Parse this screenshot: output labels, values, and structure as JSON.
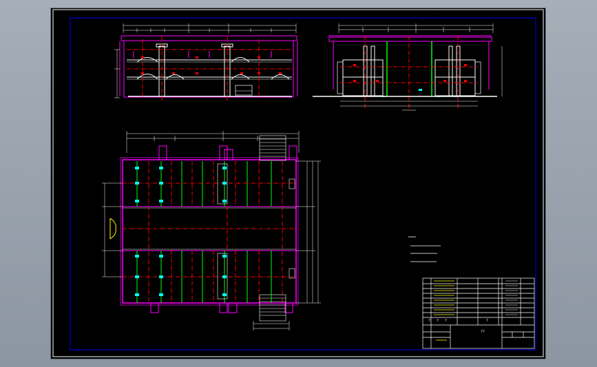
{
  "colors": {
    "background": "#000000",
    "viewport": "#9aa3ae",
    "frame": "#ffffff",
    "inner_frame": "#0000ff",
    "wall": "#ff00ff",
    "axis": "#ff0000",
    "green": "#00ff00",
    "cyan": "#00ffff",
    "yellow": "#ffff00",
    "white": "#ffffff"
  },
  "title_block": {
    "drawing_title": "??",
    "row_marks": [
      "?",
      "?",
      "?",
      "?"
    ]
  }
}
